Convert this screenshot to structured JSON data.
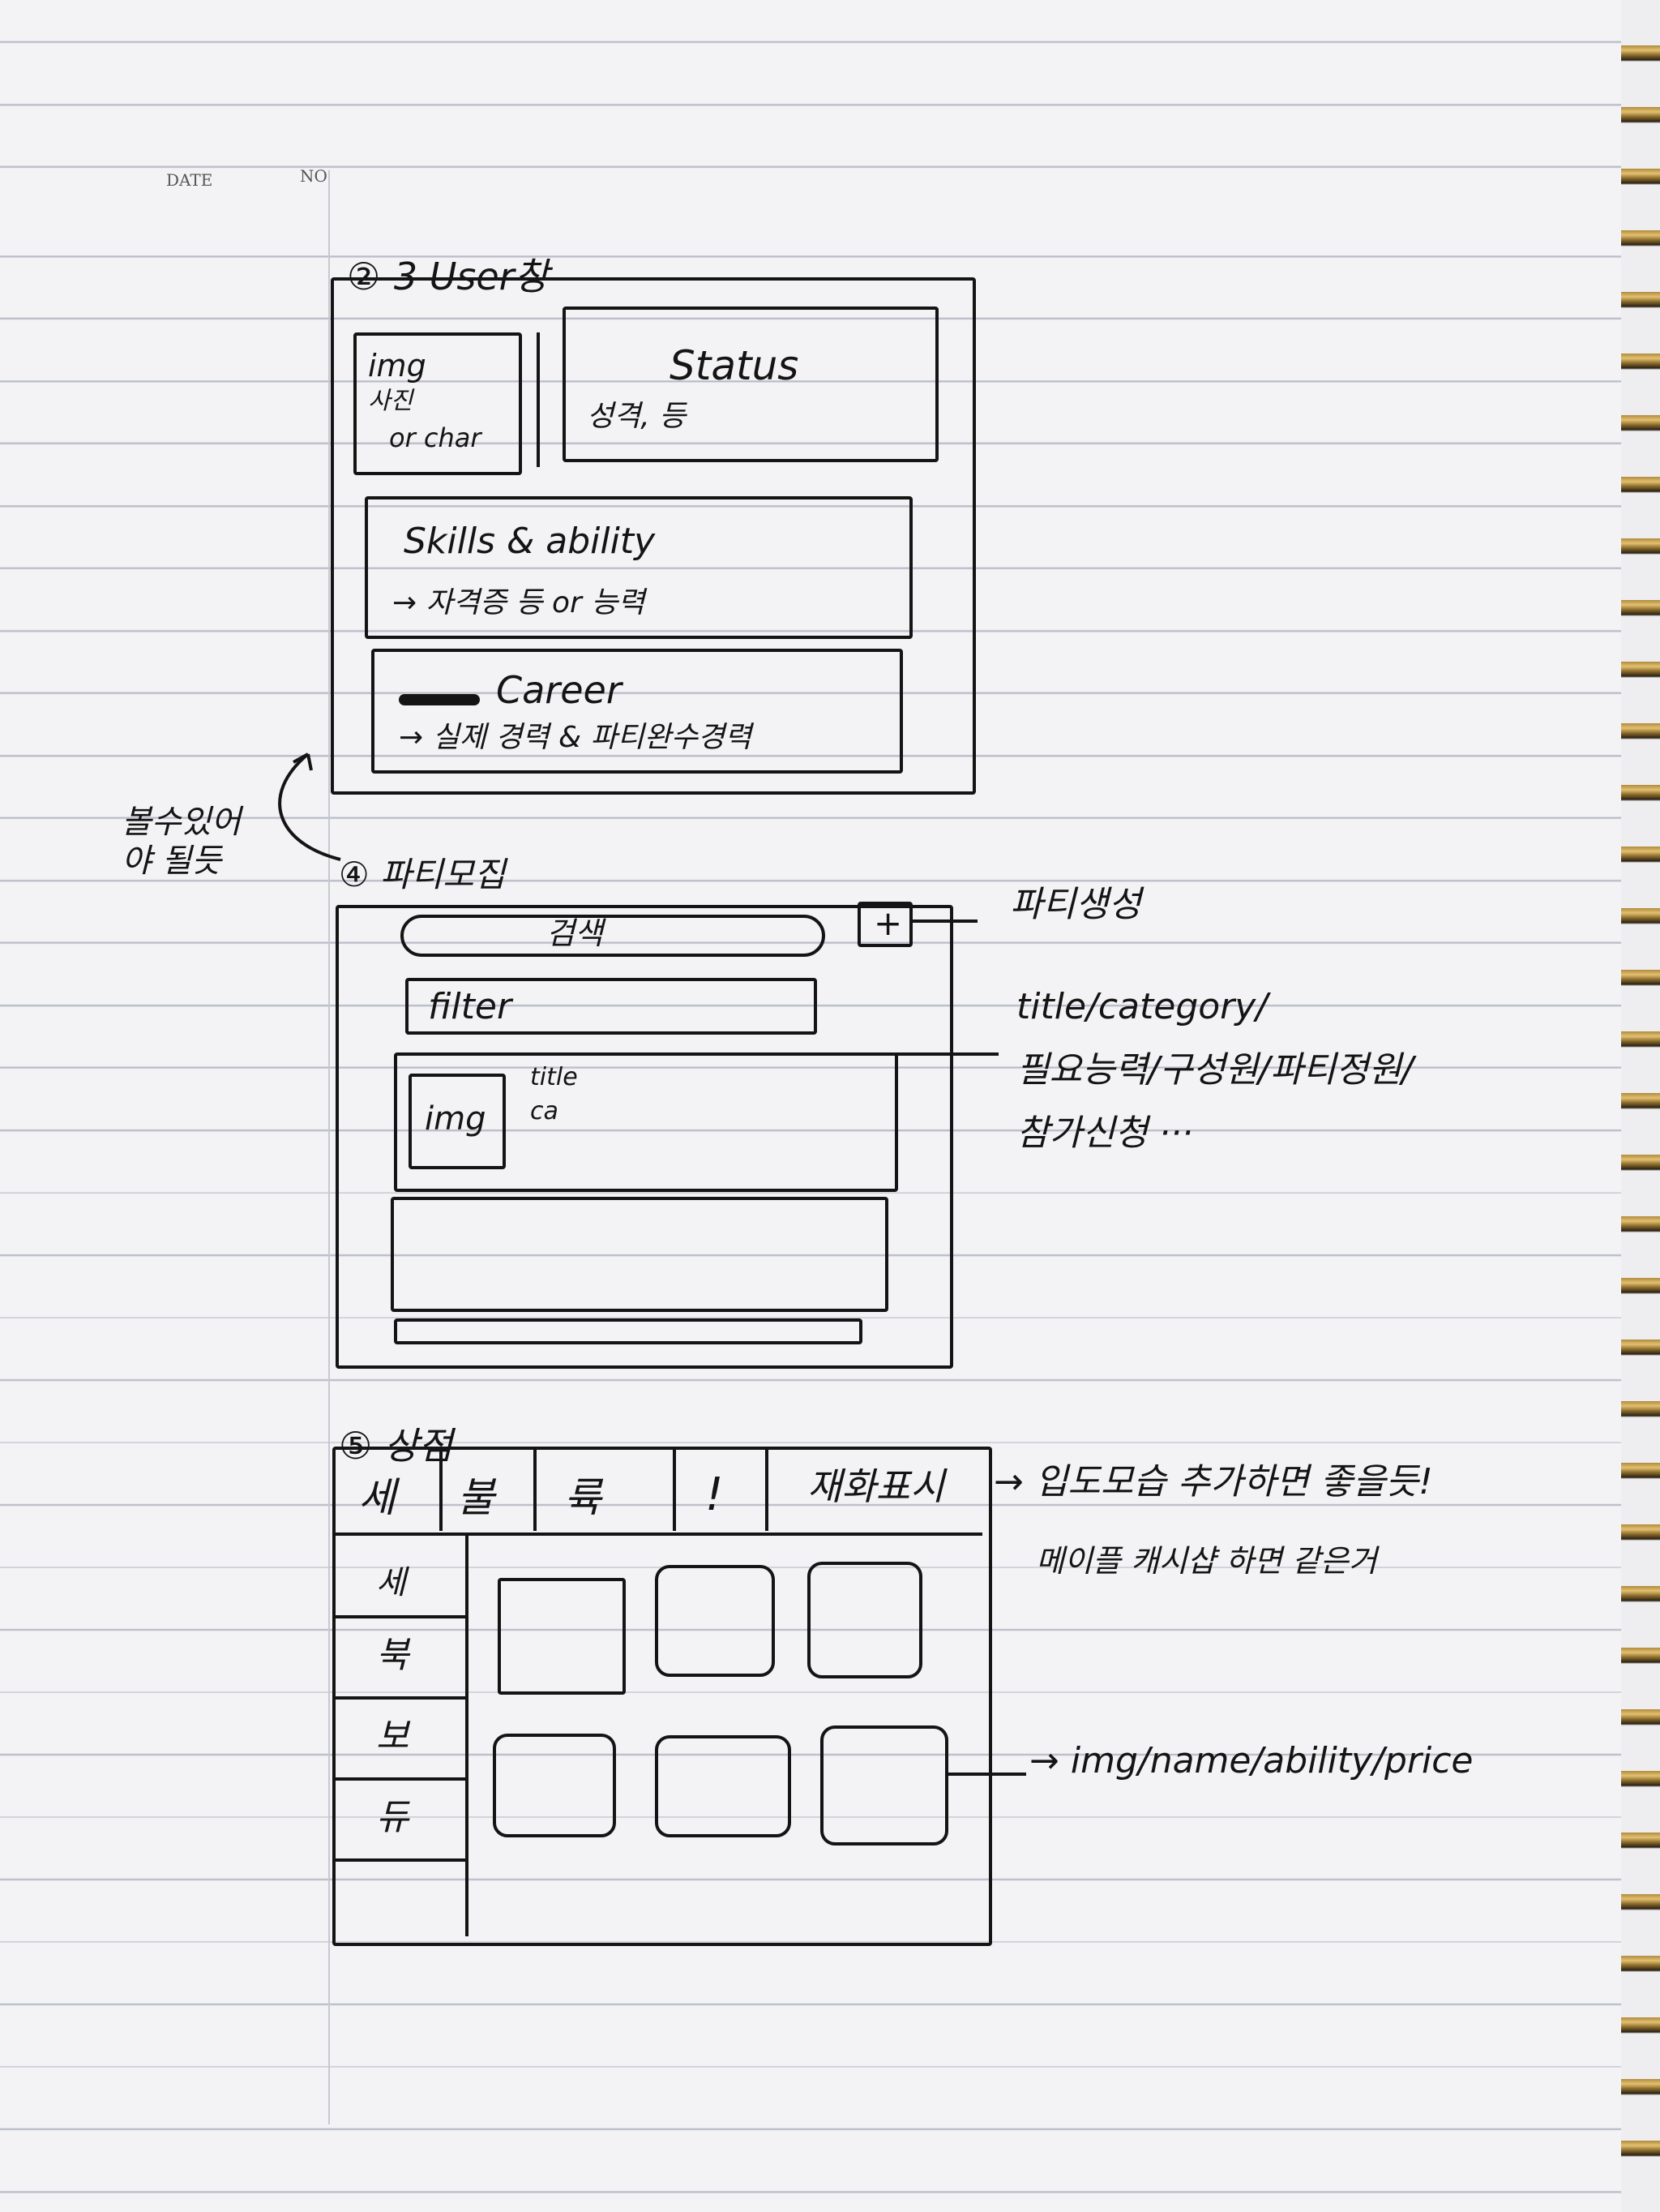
{
  "header": {
    "date_label": "DATE",
    "no_label": "NO"
  },
  "user_window": {
    "heading": "②-3 User창",
    "img_box": {
      "line1": "img",
      "line2": "사진",
      "line3": "or char"
    },
    "status_box": {
      "title": "Status",
      "subtitle": "성격, 등"
    },
    "skills_box": {
      "title": "Skills & ability",
      "subtitle": "→ 자격증 등 or 능력"
    },
    "career_box": {
      "title": "Career",
      "subtitle": "→ 실제 경력 & 파티완수경력"
    },
    "side_note": "볼수있어야 될듯"
  },
  "party_recruit": {
    "heading": "④ 파티모집",
    "search_label": "검색",
    "add_button": "+",
    "add_note": "파티생성",
    "filter_label": "filter",
    "card": {
      "img": "img",
      "title": "title",
      "category": "ca"
    },
    "card_note_line1": "title/category/",
    "card_note_line2": "필요능력/구성원/파티정원/",
    "card_note_line3": "참가신청 ···"
  },
  "shop": {
    "heading": "⑤ 상점",
    "tabs": [
      "세",
      "불",
      "륙",
      "!",
      "재화표시"
    ],
    "side_items": [
      "세",
      "북",
      "보",
      "듀"
    ],
    "tabs_note": "→ 입도모습 추가하면 좋을듯!",
    "shop_note": "메이플 캐시샵 하면 같은거",
    "item_note": "→ img/name/ability/price"
  }
}
